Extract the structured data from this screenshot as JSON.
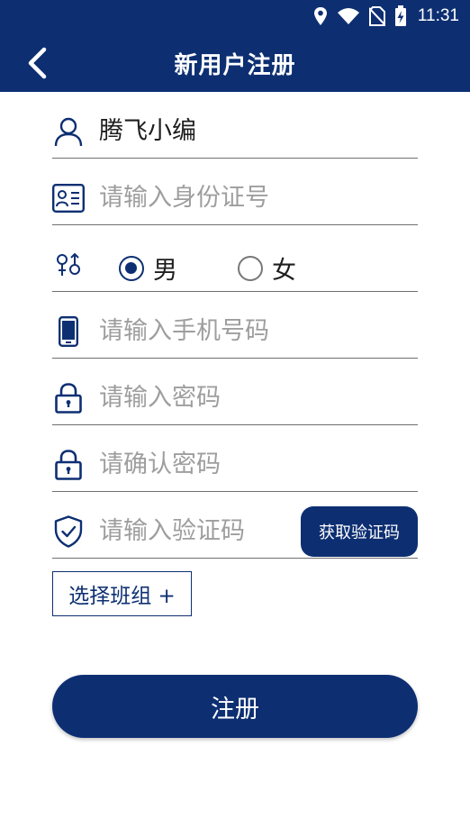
{
  "status_bar": {
    "time": "11:31"
  },
  "header": {
    "title": "新用户注册"
  },
  "form": {
    "username_value": "腾飞小编",
    "id_placeholder": "请输入身份证号",
    "gender_male": "男",
    "gender_female": "女",
    "gender_selected": "男",
    "phone_placeholder": "请输入手机号码",
    "password_placeholder": "请输入密码",
    "confirm_placeholder": "请确认密码",
    "code_placeholder": "请输入验证码",
    "get_code_label": "获取验证码",
    "select_team_label": "选择班组 +",
    "register_label": "注册"
  },
  "colors": {
    "primary": "#0d2f72",
    "placeholder": "#9e9e9e",
    "divider": "#6f6f6f"
  },
  "icons": [
    "location-icon",
    "wifi-icon",
    "no-sim-icon",
    "battery-charging-icon",
    "back-arrow-icon",
    "user-icon",
    "id-card-icon",
    "gender-icon",
    "phone-icon",
    "lock-icon",
    "shield-check-icon"
  ]
}
